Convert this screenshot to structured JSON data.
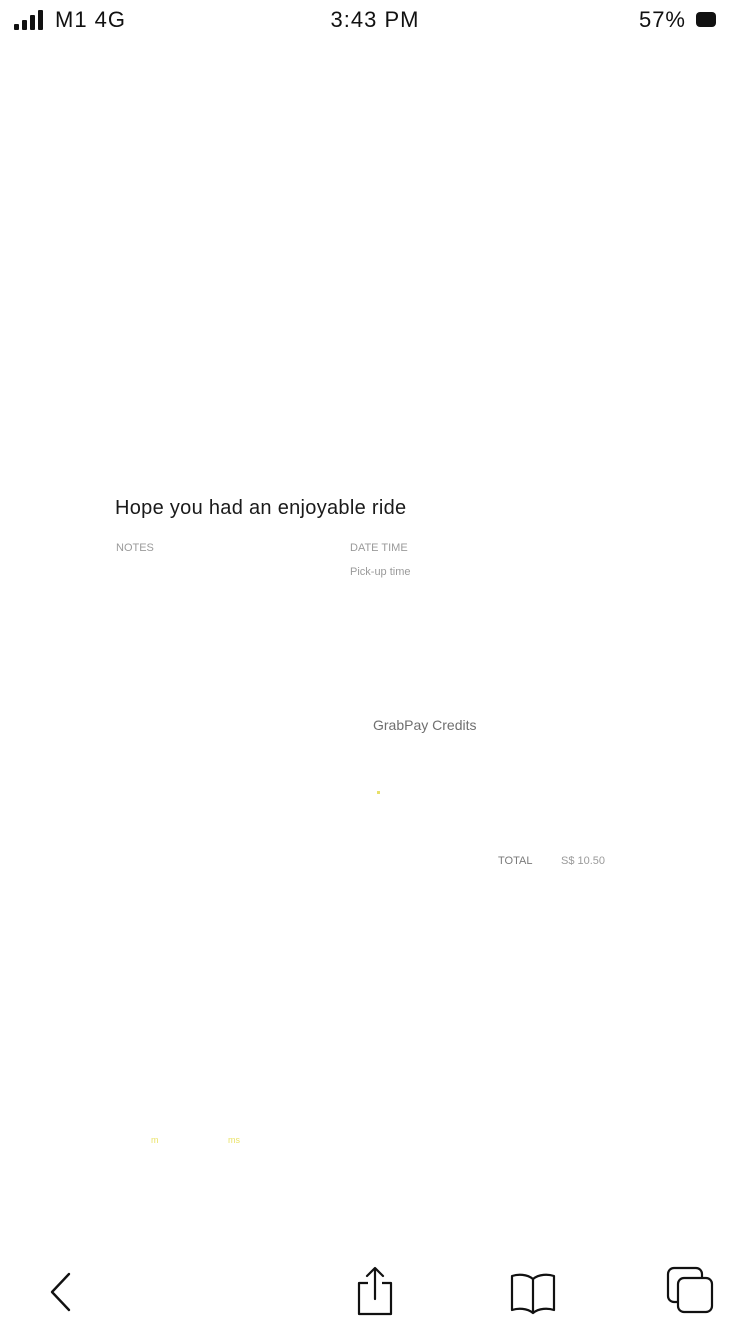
{
  "status_bar": {
    "carrier": "M1  4G",
    "time": "3:43 PM",
    "battery": "57%"
  },
  "receipt": {
    "heading": "Hope you had an enjoyable ride",
    "notes_label": "NOTES",
    "date_time_label": "DATE  TIME",
    "pickup_label": "Pick-up time",
    "payment_method": "GrabPay Credits",
    "total_label": "TOTAL",
    "total_value": "S$ 10.50",
    "footer_left": "m",
    "footer_right": "ms"
  },
  "toolbar": {
    "icons": [
      "back-icon",
      "share-icon",
      "bookmarks-icon",
      "tabs-icon"
    ]
  }
}
